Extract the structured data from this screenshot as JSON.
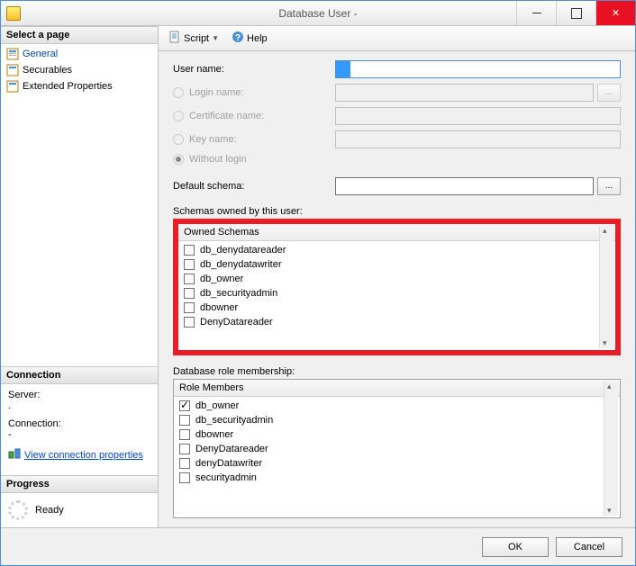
{
  "window": {
    "title": "Database User - "
  },
  "sidebar": {
    "select_page_label": "Select a page",
    "pages": [
      {
        "label": "General",
        "selected": true
      },
      {
        "label": "Securables",
        "selected": false
      },
      {
        "label": "Extended Properties",
        "selected": false
      }
    ],
    "connection": {
      "heading": "Connection",
      "server_label": "Server:",
      "server_value": ".",
      "connection_label": "Connection:",
      "connection_value": "-",
      "view_props_link": "View connection properties"
    },
    "progress": {
      "heading": "Progress",
      "status": "Ready"
    }
  },
  "toolbar": {
    "script_label": "Script",
    "help_label": "Help"
  },
  "form": {
    "user_name_label": "User name:",
    "user_name_value": "",
    "login_name_label": "Login name:",
    "certificate_name_label": "Certificate name:",
    "key_name_label": "Key name:",
    "without_login_label": "Without login",
    "default_schema_label": "Default schema:",
    "default_schema_value": ""
  },
  "owned_schemas": {
    "group_label": "Schemas owned by this user:",
    "header": "Owned Schemas",
    "items": [
      {
        "label": "db_denydatareader",
        "checked": false
      },
      {
        "label": "db_denydatawriter",
        "checked": false
      },
      {
        "label": "db_owner",
        "checked": false
      },
      {
        "label": "db_securityadmin",
        "checked": false
      },
      {
        "label": "dbowner",
        "checked": false
      },
      {
        "label": "DenyDatareader",
        "checked": false
      }
    ]
  },
  "role_membership": {
    "group_label": "Database role membership:",
    "header": "Role Members",
    "items": [
      {
        "label": "db_owner",
        "checked": true
      },
      {
        "label": "db_securityadmin",
        "checked": false
      },
      {
        "label": "dbowner",
        "checked": false
      },
      {
        "label": "DenyDatareader",
        "checked": false
      },
      {
        "label": "denyDatawriter",
        "checked": false
      },
      {
        "label": "securityadmin",
        "checked": false
      }
    ]
  },
  "footer": {
    "ok": "OK",
    "cancel": "Cancel"
  }
}
